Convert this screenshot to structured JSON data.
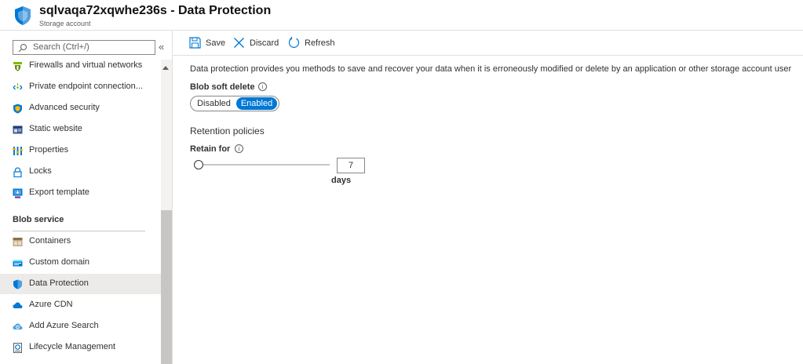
{
  "header": {
    "title": "sqlvaqa72xqwhe236s - Data Protection",
    "subtitle": "Storage account",
    "logo_icon": "storage-shield-icon"
  },
  "sidebar": {
    "search_placeholder": "Search (Ctrl+/)",
    "collapse_glyph": "«",
    "items": [
      {
        "label": "Firewalls and virtual networks",
        "icon": "firewall-icon"
      },
      {
        "label": "Private endpoint connection...",
        "icon": "private-endpoint-icon"
      },
      {
        "label": "Advanced security",
        "icon": "shield-icon"
      },
      {
        "label": "Static website",
        "icon": "static-website-icon"
      },
      {
        "label": "Properties",
        "icon": "properties-icon"
      },
      {
        "label": "Locks",
        "icon": "lock-icon"
      },
      {
        "label": "Export template",
        "icon": "export-template-icon"
      }
    ],
    "section_label": "Blob service",
    "blob_items": [
      {
        "label": "Containers",
        "icon": "containers-icon"
      },
      {
        "label": "Custom domain",
        "icon": "custom-domain-icon"
      },
      {
        "label": "Data Protection",
        "icon": "data-protection-icon",
        "active": true
      },
      {
        "label": "Azure CDN",
        "icon": "cloud-icon"
      },
      {
        "label": "Add Azure Search",
        "icon": "azure-search-icon"
      },
      {
        "label": "Lifecycle Management",
        "icon": "lifecycle-icon"
      }
    ]
  },
  "toolbar": {
    "save_label": "Save",
    "discard_label": "Discard",
    "refresh_label": "Refresh"
  },
  "content": {
    "description": "Data protection provides you methods to save and recover your data when it is erroneously modified or delete by an application or other storage account user",
    "soft_delete_label": "Blob soft delete",
    "toggle_off": "Disabled",
    "toggle_on": "Enabled",
    "toggle_selected": "Enabled",
    "retention_heading": "Retention policies",
    "retain_label": "Retain for",
    "retain_value": "7",
    "retain_unit": "days",
    "slider_fraction": 0.0
  },
  "colors": {
    "accent": "#0078d4",
    "active_bg": "#edebe9",
    "border": "#e1dfdd"
  }
}
